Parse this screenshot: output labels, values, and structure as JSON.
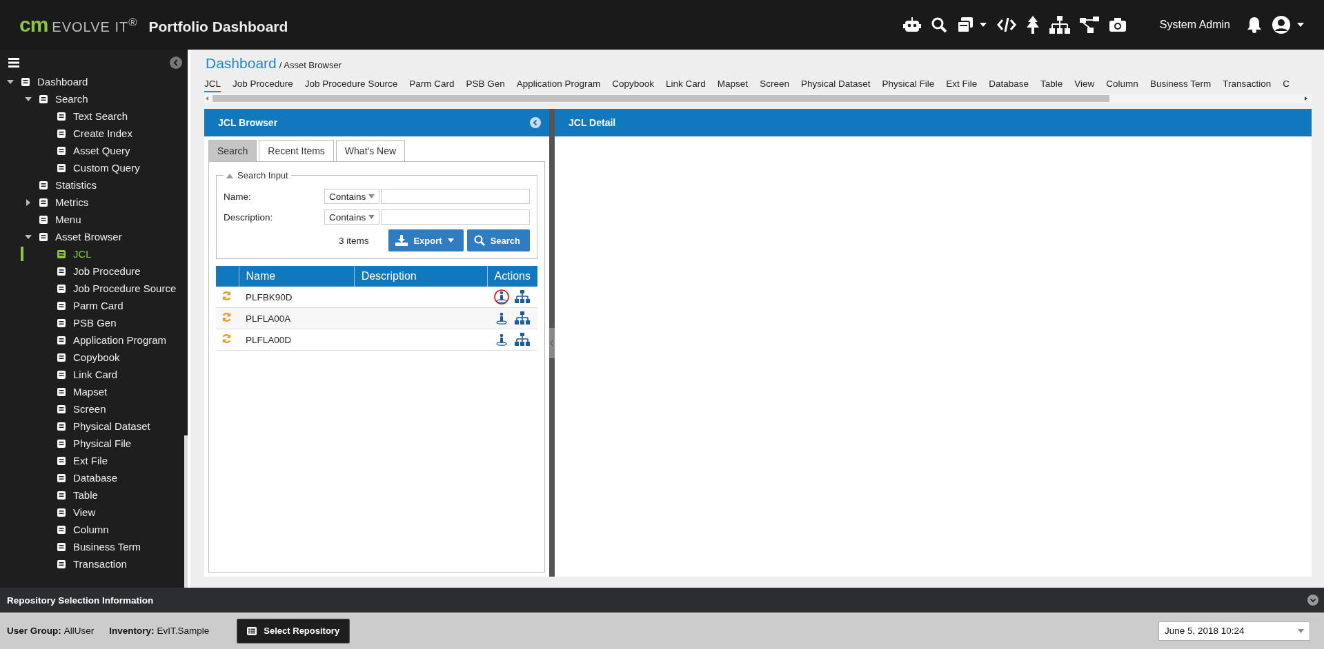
{
  "header": {
    "logo_mark": "cm",
    "logo_text": "EVOLVE IT$^{®}$",
    "title": "Portfolio Dashboard",
    "user": "System Admin"
  },
  "sidebar": {
    "items": [
      {
        "label": "Dashboard",
        "expanded": true,
        "selected": false,
        "children": [
          {
            "label": "Search",
            "expanded": true,
            "selected": false,
            "children": [
              {
                "label": "Text Search",
                "selected": false
              },
              {
                "label": "Create Index",
                "selected": false
              },
              {
                "label": "Asset Query",
                "selected": false
              },
              {
                "label": "Custom Query",
                "selected": false
              }
            ]
          },
          {
            "label": "Statistics",
            "selected": false
          },
          {
            "label": "Metrics",
            "expanded": false,
            "selected": false
          },
          {
            "label": "Menu",
            "selected": false
          },
          {
            "label": "Asset Browser",
            "expanded": true,
            "selected": false,
            "children": [
              {
                "label": "JCL",
                "selected": true
              },
              {
                "label": "Job Procedure",
                "selected": false
              },
              {
                "label": "Job Procedure Source",
                "selected": false
              },
              {
                "label": "Parm Card",
                "selected": false
              },
              {
                "label": "PSB Gen",
                "selected": false
              },
              {
                "label": "Application Program",
                "selected": false
              },
              {
                "label": "Copybook",
                "selected": false
              },
              {
                "label": "Link Card",
                "selected": false
              },
              {
                "label": "Mapset",
                "selected": false
              },
              {
                "label": "Screen",
                "selected": false
              },
              {
                "label": "Physical Dataset",
                "selected": false
              },
              {
                "label": "Physical File",
                "selected": false
              },
              {
                "label": "Ext File",
                "selected": false
              },
              {
                "label": "Database",
                "selected": false
              },
              {
                "label": "Table",
                "selected": false
              },
              {
                "label": "View",
                "selected": false
              },
              {
                "label": "Column",
                "selected": false
              },
              {
                "label": "Business Term",
                "selected": false
              },
              {
                "label": "Transaction",
                "selected": false
              }
            ]
          }
        ]
      }
    ]
  },
  "breadcrumb": {
    "title": "Dashboard",
    "trail": "/ Asset Browser"
  },
  "asset_tabs": [
    {
      "label": "JCL",
      "selected": true
    },
    {
      "label": "Job Procedure",
      "selected": false
    },
    {
      "label": "Job Procedure Source",
      "selected": false
    },
    {
      "label": "Parm Card",
      "selected": false
    },
    {
      "label": "PSB Gen",
      "selected": false
    },
    {
      "label": "Application Program",
      "selected": false
    },
    {
      "label": "Copybook",
      "selected": false
    },
    {
      "label": "Link Card",
      "selected": false
    },
    {
      "label": "Mapset",
      "selected": false
    },
    {
      "label": "Screen",
      "selected": false
    },
    {
      "label": "Physical Dataset",
      "selected": false
    },
    {
      "label": "Physical File",
      "selected": false
    },
    {
      "label": "Ext File",
      "selected": false
    },
    {
      "label": "Database",
      "selected": false
    },
    {
      "label": "Table",
      "selected": false
    },
    {
      "label": "View",
      "selected": false
    },
    {
      "label": "Column",
      "selected": false
    },
    {
      "label": "Business Term",
      "selected": false
    },
    {
      "label": "Transaction",
      "selected": false
    },
    {
      "label": "C",
      "selected": false
    }
  ],
  "browser": {
    "title": "JCL Browser",
    "tabs": [
      {
        "label": "Search",
        "selected": true
      },
      {
        "label": "Recent Items",
        "selected": false
      },
      {
        "label": "What's New",
        "selected": false
      }
    ],
    "search_input": {
      "legend": "Search Input",
      "expanded": true,
      "fields": [
        {
          "label": "Name:",
          "operator": "Contains"
        },
        {
          "label": "Description:",
          "operator": "Contains"
        }
      ],
      "count": "3 items",
      "export_button": "Export",
      "search_button": "Search"
    },
    "table": {
      "columns": [
        "Name",
        "Description",
        "Actions"
      ],
      "rows": [
        {
          "name": "PLFBK90D",
          "selected": false,
          "circled": true
        },
        {
          "name": "PLFLA00A",
          "selected": false,
          "circled": false
        },
        {
          "name": "PLFLA00D",
          "selected": false,
          "circled": false
        }
      ]
    }
  },
  "detail": {
    "title": "JCL Detail"
  },
  "repository": {
    "title": "Repository Selection Information",
    "user_group_label": "User Group:",
    "user_group": "AllUser",
    "inventory_label": "Inventory:",
    "inventory": "EvIT.Sample",
    "button": "Select Repository",
    "date": "June 5, 2018 10:24"
  }
}
